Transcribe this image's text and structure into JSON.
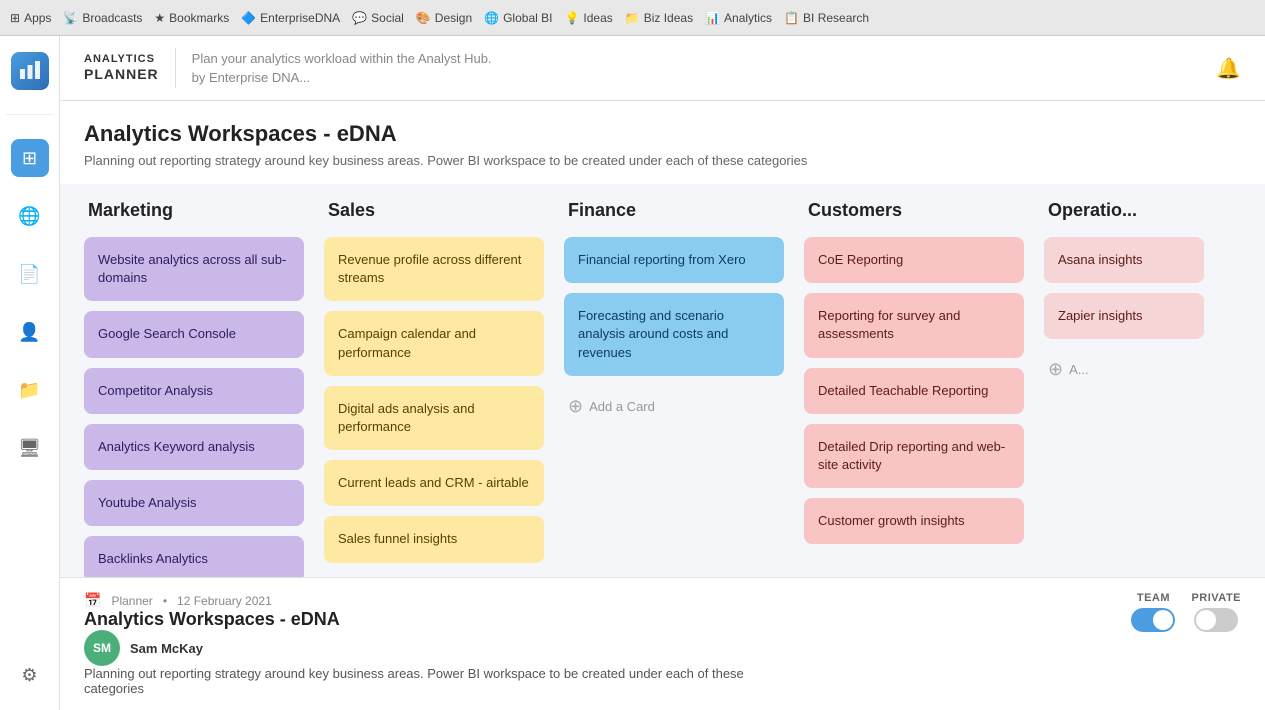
{
  "browser": {
    "items": [
      "Apps",
      "Broadcasts",
      "Bookmarks",
      "EnterpriseDNA",
      "Social",
      "Design",
      "Global BI",
      "Ideas",
      "Biz Ideas",
      "Analytics",
      "BI Research"
    ]
  },
  "header": {
    "logo_top": "ANALYTICS",
    "logo_bottom": "PLANNER",
    "tagline_line1": "Plan your analytics workload within the Analyst Hub.",
    "tagline_line2": "by Enterprise DNA..."
  },
  "page": {
    "title": "Analytics Workspaces - eDNA",
    "subtitle": "Planning out reporting strategy around key business areas. Power BI workspace to be created under each of these categories"
  },
  "columns": [
    {
      "id": "marketing",
      "label": "Marketing",
      "cards": [
        {
          "text": "Website analytics across all sub-domains",
          "color": "purple"
        },
        {
          "text": "Google Search Console",
          "color": "purple"
        },
        {
          "text": "Competitor Analysis",
          "color": "purple"
        },
        {
          "text": "Analytics Keyword analysis",
          "color": "purple"
        },
        {
          "text": "Youtube Analysis",
          "color": "purple"
        },
        {
          "text": "Backlinks Analytics",
          "color": "purple"
        }
      ]
    },
    {
      "id": "sales",
      "label": "Sales",
      "cards": [
        {
          "text": "Revenue profile across different streams",
          "color": "yellow"
        },
        {
          "text": "Campaign calendar and performance",
          "color": "yellow"
        },
        {
          "text": "Digital ads analysis and performance",
          "color": "yellow"
        },
        {
          "text": "Current leads and CRM - airtable",
          "color": "yellow"
        },
        {
          "text": "Sales funnel insights",
          "color": "yellow"
        }
      ]
    },
    {
      "id": "finance",
      "label": "Finance",
      "cards": [
        {
          "text": "Financial reporting from Xero",
          "color": "blue"
        },
        {
          "text": "Forecasting and scenario analysis around costs and revenues",
          "color": "blue"
        }
      ],
      "add_card_label": "Add a Card"
    },
    {
      "id": "customers",
      "label": "Customers",
      "cards": [
        {
          "text": "CoE Reporting",
          "color": "pink"
        },
        {
          "text": "Reporting for survey and assessments",
          "color": "pink"
        },
        {
          "text": "Detailed Teachable Reporting",
          "color": "pink"
        },
        {
          "text": "Detailed Drip reporting and web-site activity",
          "color": "pink"
        },
        {
          "text": "Customer growth insights",
          "color": "pink"
        }
      ]
    },
    {
      "id": "operations",
      "label": "Operations",
      "cards": [
        {
          "text": "Asana insights",
          "color": "light-pink"
        },
        {
          "text": "Zapier insights",
          "color": "light-pink"
        }
      ],
      "add_card_label": "A..."
    }
  ],
  "bottom_panel": {
    "meta_date": "12 February 2021",
    "meta_source": "Planner",
    "title": "Analytics Workspaces - eDNA",
    "author": "Sam McKay",
    "author_initials": "SM",
    "description": "Planning out reporting strategy around key business areas. Power BI workspace to be created under each of these categories",
    "team_label": "TEAM",
    "private_label": "PRIVATE"
  }
}
